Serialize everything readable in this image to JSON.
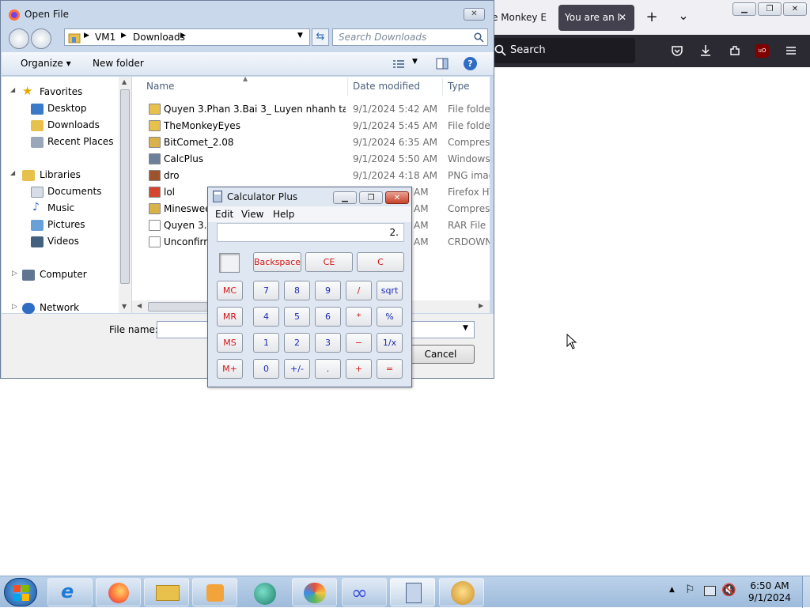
{
  "firefox": {
    "tab1_label": "e Monkey E",
    "tab2_label": "You are an I",
    "tab2_close": "✕",
    "new_tab": "+",
    "list_tabs": "⌄",
    "search_placeholder": "Search",
    "extension_badge": "uO"
  },
  "window_controls": {
    "minimize": "▁",
    "restore": "❐",
    "close": "✕"
  },
  "open_file": {
    "title": "Open File",
    "close": "✕",
    "breadcrumb": [
      "VM1",
      "Downloads"
    ],
    "search_placeholder": "Search Downloads",
    "organize_label": "Organize ▾",
    "new_folder_label": "New folder",
    "help": "?",
    "columns": {
      "name": "Name",
      "date": "Date modified",
      "type": "Type"
    },
    "nav": {
      "favorites": "Favorites",
      "desktop": "Desktop",
      "downloads": "Downloads",
      "recent_places": "Recent Places",
      "libraries": "Libraries",
      "documents": "Documents",
      "music": "Music",
      "pictures": "Pictures",
      "videos": "Videos",
      "computer": "Computer",
      "network": "Network"
    },
    "files": [
      {
        "name": "Quyen 3.Phan 3.Bai 3_ Luyen nhanh tay ti...",
        "date": "9/1/2024 5:42 AM",
        "type": "File folder",
        "icon": "folder-icon"
      },
      {
        "name": "TheMonkeyEyes",
        "date": "9/1/2024 5:45 AM",
        "type": "File folder",
        "icon": "folder-icon"
      },
      {
        "name": "BitComet_2.08",
        "date": "9/1/2024 6:35 AM",
        "type": "Compress",
        "icon": "zip-folder-icon"
      },
      {
        "name": "CalcPlus",
        "date": "9/1/2024 5:50 AM",
        "type": "Windows",
        "icon": "installer-icon"
      },
      {
        "name": "dro",
        "date": "9/1/2024 4:18 AM",
        "type": "PNG imag",
        "icon": "image-icon"
      },
      {
        "name": "lol",
        "date": "",
        "type": "Firefox HT",
        "icon": "html-icon"
      },
      {
        "name": "Minesweep",
        "date": "",
        "type": "Compress",
        "icon": "zip-folder-icon"
      },
      {
        "name": "Quyen 3.P",
        "date": "",
        "type": "RAR File",
        "icon": "file-icon"
      },
      {
        "name": "Unconfirm",
        "date": "",
        "type": "CRDOWN",
        "icon": "file-icon"
      }
    ],
    "partial_dates": [
      "AM",
      "AM",
      "AM",
      "AM"
    ],
    "file_name_label": "File name:",
    "file_name_value": "",
    "cancel_label": "Cancel"
  },
  "calculator": {
    "title": "Calculator Plus",
    "menu": [
      "Edit",
      "View",
      "Help"
    ],
    "display": "2.",
    "top_keys": [
      "Backspace",
      "CE",
      "C"
    ],
    "rows": [
      [
        "MC",
        "7",
        "8",
        "9",
        "/",
        "sqrt"
      ],
      [
        "MR",
        "4",
        "5",
        "6",
        "*",
        "%"
      ],
      [
        "MS",
        "1",
        "2",
        "3",
        "−",
        "1/x"
      ],
      [
        "M+",
        "0",
        "+/-",
        ".",
        "+",
        "="
      ]
    ]
  },
  "taskbar": {
    "clock_time": "6:50 AM",
    "clock_date": "9/1/2024",
    "pinned": [
      "internet-explorer-icon",
      "firefox-icon",
      "file-explorer-icon",
      "media-player-icon",
      "app-sphere-icon",
      "paint-icon",
      "infinity-app-icon",
      "calculator-icon",
      "monkey-app-icon"
    ]
  },
  "colors": {
    "firefox_dark": "#2b2a33",
    "dialog_frame": "#c9d8eb",
    "calc_red": "#d01818",
    "calc_blue": "#1c2bb8"
  }
}
